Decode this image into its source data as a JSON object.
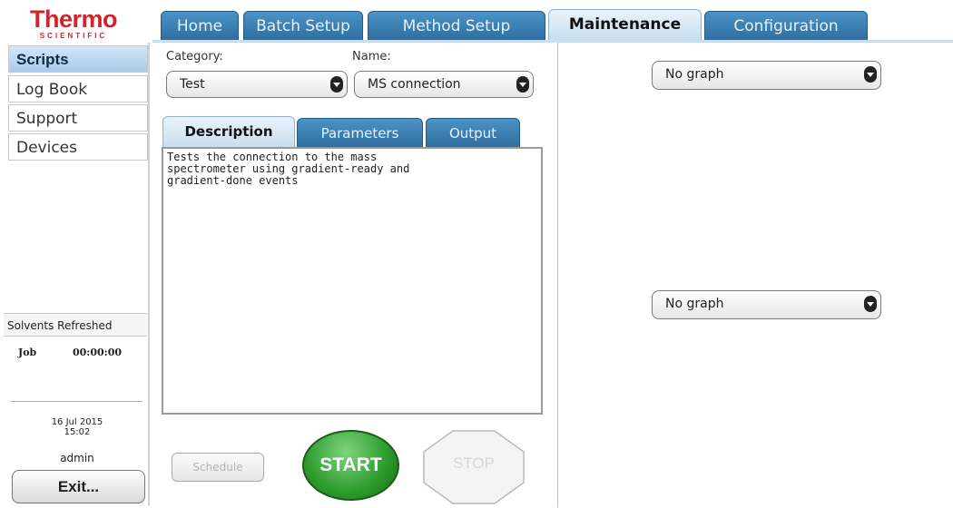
{
  "brand": {
    "name": "Thermo",
    "sub": "SCIENTIFIC"
  },
  "top_tabs": [
    {
      "label": "Home"
    },
    {
      "label": "Batch Setup"
    },
    {
      "label": "Method Setup"
    },
    {
      "label": "Maintenance",
      "active": true
    },
    {
      "label": "Configuration"
    }
  ],
  "sidebar": {
    "items": [
      {
        "label": "Scripts",
        "active": true
      },
      {
        "label": "Log Book"
      },
      {
        "label": "Support"
      },
      {
        "label": "Devices"
      }
    ],
    "status": "Solvents Refreshed",
    "job_label": "Job",
    "job_time": "00:00:00",
    "date": "16 Jul 2015",
    "time": "15:02",
    "user": "admin",
    "exit_label": "Exit..."
  },
  "form": {
    "category_label": "Category:",
    "category_value": "Test",
    "name_label": "Name:",
    "name_value": "MS connection"
  },
  "sub_tabs": [
    {
      "label": "Description",
      "active": true
    },
    {
      "label": "Parameters"
    },
    {
      "label": "Output"
    }
  ],
  "description": "Tests the connection to the mass\nspectrometer using gradient-ready and\ngradient-done events",
  "graphs": {
    "top_value": "No graph",
    "bottom_value": "No graph"
  },
  "buttons": {
    "schedule": "Schedule",
    "start": "START",
    "stop": "STOP"
  },
  "colors": {
    "brand_red": "#d2232a",
    "tab_blue": "#2f6ea0",
    "start_green": "#2a9a2a"
  }
}
